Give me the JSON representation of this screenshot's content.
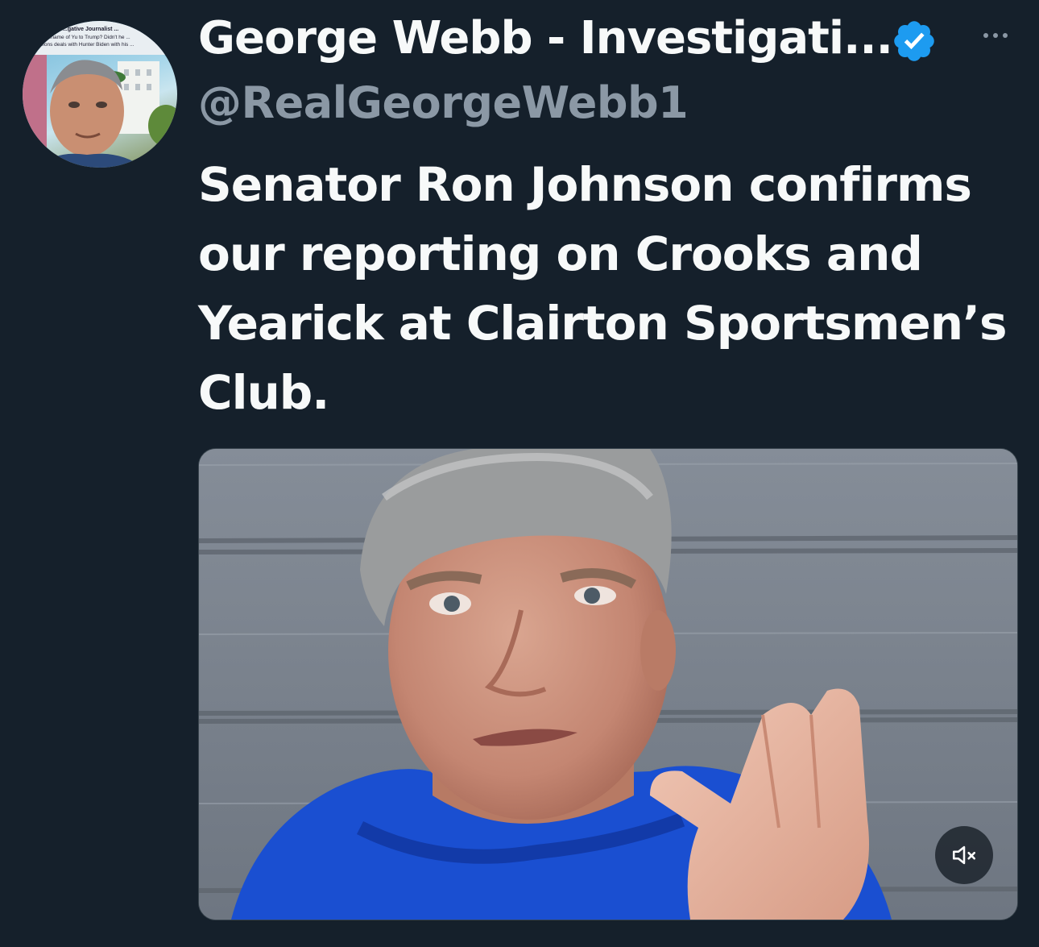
{
  "author": {
    "name": "George Webb - Investigati...",
    "handle": "@RealGeorgeWebb1",
    "verified": true,
    "avatar_caption_lines": [
      "...gative Journalist ...",
      "...name of Yu to Trump? Didn't he ...",
      "...ions deals with Hunter Biden with his ..."
    ]
  },
  "tweet": {
    "text_lines": [
      "Senator Ron Johnson confirms",
      "our reporting on Crooks and",
      "Yearick at Clairton Sportsmen’s",
      "Club."
    ]
  },
  "media": {
    "type": "video",
    "muted": true
  },
  "icons": {
    "verified": "verified-badge-icon",
    "more": "more-options-icon",
    "mute": "volume-muted-icon"
  },
  "colors": {
    "background": "#15202b",
    "text_primary": "#f7f9f9",
    "text_secondary": "#8b98a5",
    "verified_blue": "#1d9bf0"
  }
}
